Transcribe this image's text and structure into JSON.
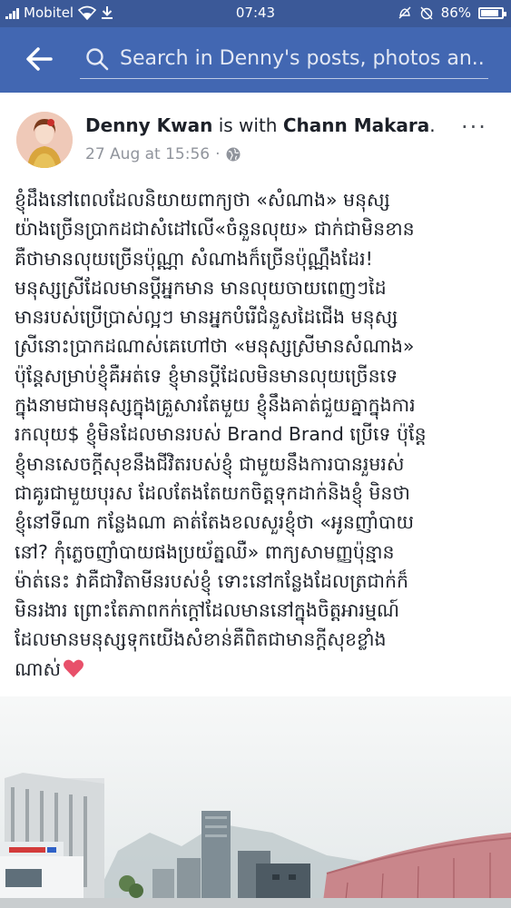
{
  "status_bar": {
    "carrier": "Mobitel",
    "time": "07:43",
    "battery": "86%",
    "battery_level": 0.86
  },
  "search": {
    "placeholder": "Search in Denny's posts, photos an..."
  },
  "post": {
    "author": "Denny Kwan",
    "with_text": "is with",
    "tagged": "Chann Makara",
    "period": ".",
    "timestamp": "27 Aug at 15:56",
    "separator": "·",
    "more": "···",
    "lines": [
      "ខ្ញុំដឹងនៅពេលដែលនិយាយពាក្យថា «សំណាង» មនុស្ស",
      "យ៉ាងច្រើនប្រាកដជាសំដៅលើ«ចំនួនលុយ» ជាក់ជាមិនខាន",
      "គឺថាមានលុយច្រើនប៉ុណ្ណា សំណាងក៏ច្រើនប៉ុណ្ណឹងដែរ!",
      "មនុស្សស្រីដែលមានប្តីអ្នកមាន មានលុយចាយពេញៗដៃ",
      "មានរបស់ប្រើប្រាស់ល្អៗ មានអ្នកបំរើជំនួសដៃជើង មនុស្ស",
      "ស្រីនោះប្រាកដណាស់គេហៅថា «មនុស្សស្រីមានសំណាង»",
      "ប៉ុន្តែសម្រាប់ខ្ញុំគឺអត់ទេ ខ្ញុំមានប្តីដែលមិនមានលុយច្រើនទេ",
      "ក្នុងនាមជាមនុស្សក្នុងគ្រួសារតែមួយ ខ្ញុំនឹងគាត់ជួយគ្នាក្នុងការ",
      "រកលុយ$ ខ្ញុំមិនដែលមានរបស់ Brand Brand ប្រើទេ ប៉ុន្តែ",
      "ខ្ញុំមានសេចក្តីសុខនឹងជីវិតរបស់ខ្ញុំ ជាមួយនឹងការបានរួមរស់",
      "ជាគូរជាមួយបុរស ដែលតែងតែយកចិត្តទុកដាក់និងខ្ញុំ មិនថា",
      "ខ្ញុំនៅទីណា កន្លែងណា គាត់តែងខលសួរខ្ញុំថា «អូនញាំបាយ",
      "នៅ? កុំភ្លេចញាំបាយផងប្រយ័ត្នឈឺ» ពាក្យសាមញ្ញប៉ុន្មាន",
      "ម៉ាត់នេះ វាគឺជាវិតាមីនរបស់ខ្ញុំ ទោះនៅកន្លែងដែលត្រជាក់ក៏",
      "មិនរងារ ព្រោះតែភាពកក់ក្តៅដែលមាននៅក្នុងចិត្តអារម្មណ៍",
      "ដែលមានមនុស្សទុកយើងសំខាន់គឺពិតជាមានក្តីសុខខ្លាំង",
      "ណាស់"
    ]
  },
  "colors": {
    "status_bar": "#3b5998",
    "header": "#4267b2",
    "name_text": "#1d2129",
    "meta_text": "#90949c",
    "heart": "#e8506a"
  },
  "icons": [
    "signal-icon",
    "wifi-icon",
    "download-icon",
    "mute-icon",
    "alarm-off-icon",
    "battery-icon",
    "back-arrow-icon",
    "search-icon",
    "globe-icon",
    "heart-icon"
  ]
}
